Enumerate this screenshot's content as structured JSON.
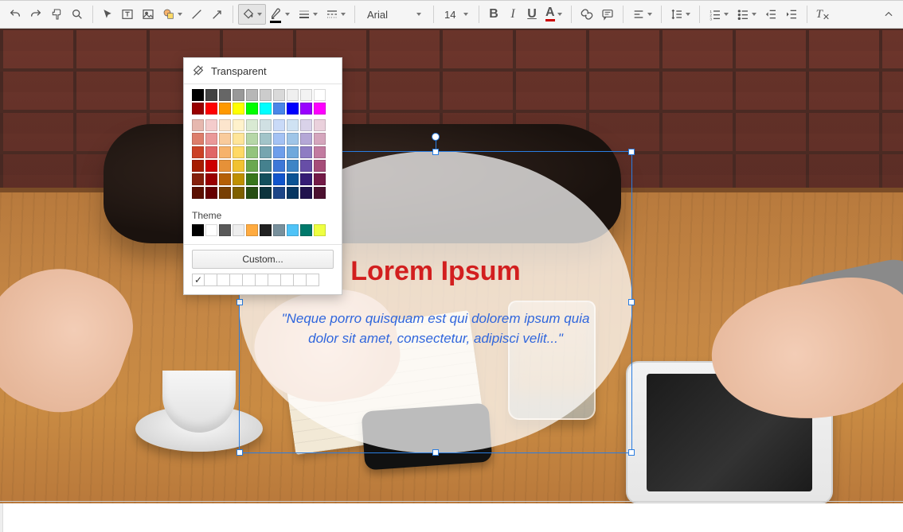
{
  "toolbar": {
    "font_name": "Arial",
    "font_size": "14"
  },
  "colorpicker": {
    "transparent_label": "Transparent",
    "theme_label": "Theme",
    "custom_label": "Custom...",
    "recent_check": "✓",
    "grays": [
      "#000000",
      "#434343",
      "#666666",
      "#999999",
      "#b7b7b7",
      "#cccccc",
      "#d9d9d9",
      "#efefef",
      "#f3f3f3",
      "#ffffff"
    ],
    "brights": [
      "#980000",
      "#ff0000",
      "#ff9900",
      "#ffff00",
      "#00ff00",
      "#00ffff",
      "#4a86e8",
      "#0000ff",
      "#9900ff",
      "#ff00ff"
    ],
    "shades": [
      [
        "#e6b8af",
        "#f4cccc",
        "#fce5cd",
        "#fff2cc",
        "#d9ead3",
        "#d0e0e3",
        "#c9daf8",
        "#cfe2f3",
        "#d9d2e9",
        "#ead1dc"
      ],
      [
        "#dd7e6b",
        "#ea9999",
        "#f9cb9c",
        "#ffe599",
        "#b6d7a8",
        "#a2c4c9",
        "#a4c2f4",
        "#9fc5e8",
        "#b4a7d6",
        "#d5a6bd"
      ],
      [
        "#cc4125",
        "#e06666",
        "#f6b26b",
        "#ffd966",
        "#93c47d",
        "#76a5af",
        "#6d9eeb",
        "#6fa8dc",
        "#8e7cc3",
        "#c27ba0"
      ],
      [
        "#a61c00",
        "#cc0000",
        "#e69138",
        "#f1c232",
        "#6aa84f",
        "#45818e",
        "#3c78d8",
        "#3d85c6",
        "#674ea7",
        "#a64d79"
      ],
      [
        "#85200c",
        "#990000",
        "#b45f06",
        "#bf9000",
        "#38761d",
        "#134f5c",
        "#1155cc",
        "#0b5394",
        "#351c75",
        "#741b47"
      ],
      [
        "#5b0f00",
        "#660000",
        "#783f04",
        "#7f6000",
        "#274e13",
        "#0c343d",
        "#1c4587",
        "#073763",
        "#20124d",
        "#4c1130"
      ]
    ],
    "theme_colors": [
      "#000000",
      "#ffffff",
      "#595959",
      "#eeeeee",
      "#ffab40",
      "#212121",
      "#78909c",
      "#4fc3f7",
      "#00796b",
      "#eeff41"
    ]
  },
  "shape": {
    "title": "Lorem Ipsum",
    "body": "\"Neque porro quisquam est qui dolorem ipsum quia dolor sit amet, consectetur, adipisci velit...\""
  }
}
